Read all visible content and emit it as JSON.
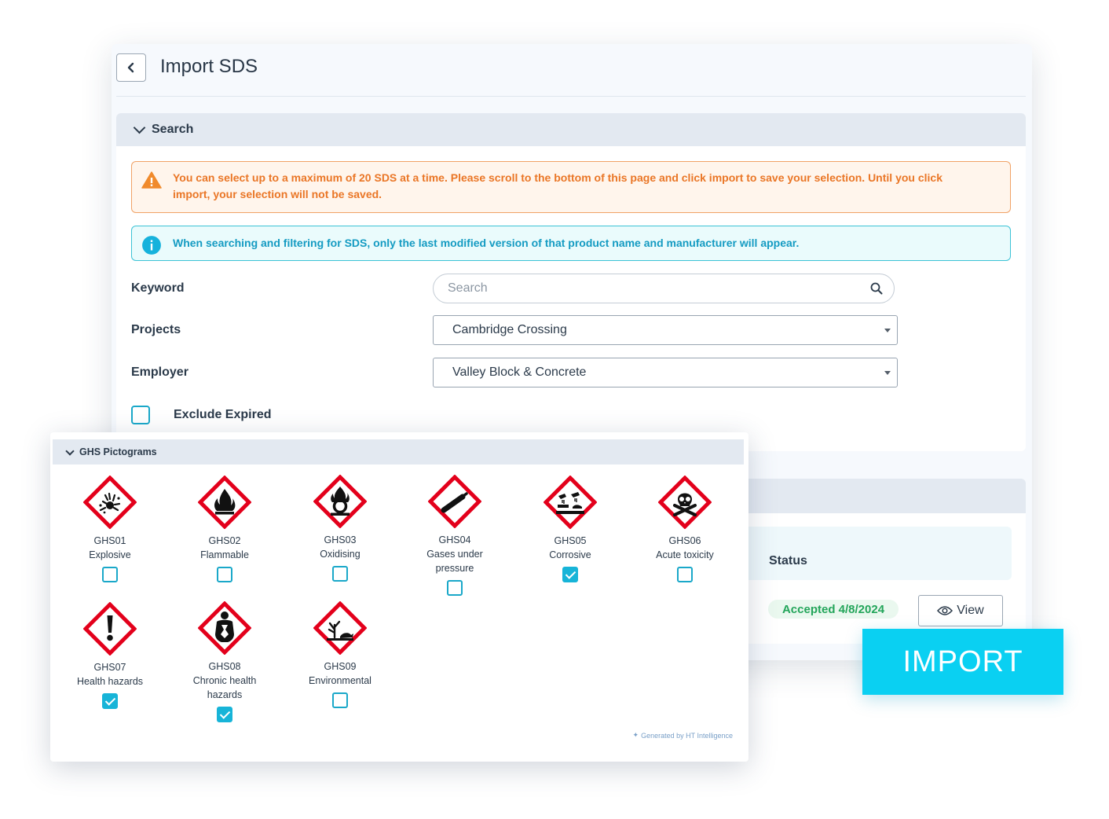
{
  "header": {
    "title": "Import SDS"
  },
  "search_section": {
    "title": "Search",
    "warning": "You can select up to a maximum of 20 SDS at a time. Please scroll to the bottom of this page and click import to save your selection. Until you click import, your selection will not be saved.",
    "info": "When searching and filtering for SDS, only the last modified version of that product name and manufacturer will appear.",
    "keyword_label": "Keyword",
    "search_placeholder": "Search",
    "projects_label": "Projects",
    "projects_value": "Cambridge Crossing",
    "employer_label": "Employer",
    "employer_value": "Valley Block & Concrete",
    "exclude_label": "Exclude Expired",
    "exclude_checked": false
  },
  "results": {
    "status_header": "Status",
    "status_value": "Accepted 4/8/2024",
    "view_label": "View"
  },
  "ghs": {
    "title": "GHS Pictograms",
    "items": [
      {
        "code": "GHS01",
        "name": "Explosive",
        "icon": "explosive-icon",
        "checked": false
      },
      {
        "code": "GHS02",
        "name": "Flammable",
        "icon": "flammable-icon",
        "checked": false
      },
      {
        "code": "GHS03",
        "name": "Oxidising",
        "icon": "oxidising-icon",
        "checked": false
      },
      {
        "code": "GHS04",
        "name": "Gases under pressure",
        "icon": "gas-cylinder-icon",
        "checked": false
      },
      {
        "code": "GHS05",
        "name": "Corrosive",
        "icon": "corrosive-icon",
        "checked": true
      },
      {
        "code": "GHS06",
        "name": "Acute toxicity",
        "icon": "skull-icon",
        "checked": false
      },
      {
        "code": "GHS07",
        "name": "Health hazards",
        "icon": "exclamation-icon",
        "checked": true
      },
      {
        "code": "GHS08",
        "name": "Chronic health hazards",
        "icon": "health-hazard-icon",
        "checked": true
      },
      {
        "code": "GHS09",
        "name": "Environmental",
        "icon": "environment-icon",
        "checked": false
      }
    ],
    "footnote": "Generated by HT Intelligence"
  },
  "import_label": "IMPORT",
  "colors": {
    "accent": "#0AD0F2",
    "checkbox": "#17B4D8",
    "warning": "#EA7626",
    "info": "#149BC2",
    "success": "#23A55A",
    "ghs_red": "#E3001B"
  }
}
